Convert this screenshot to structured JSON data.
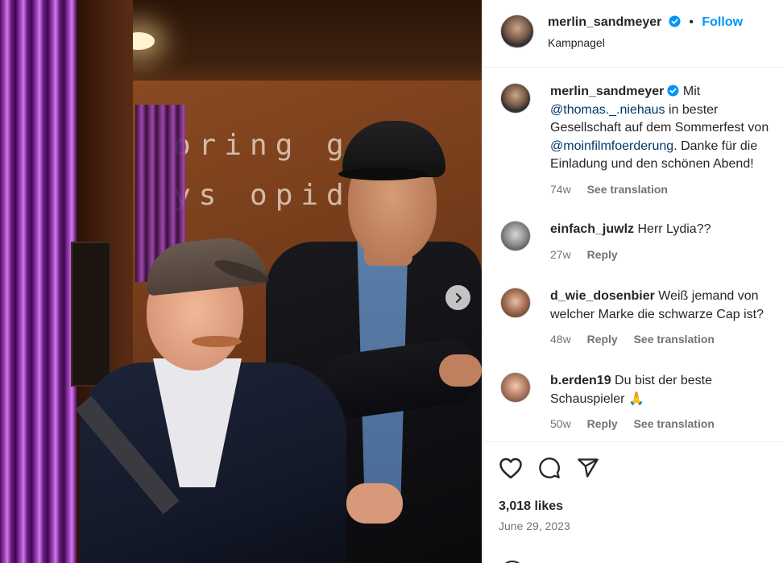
{
  "post": {
    "image_alt": "",
    "next_icon": "chevron-right-icon"
  },
  "header": {
    "username": "merlin_sandmeyer",
    "separator": "•",
    "follow_label": "Follow",
    "location": "Kampnagel"
  },
  "caption": {
    "username": "merlin_sandmeyer",
    "text_parts": [
      "Mit ",
      "@thomas._.niehaus",
      " in bester Gesellschaft auf dem Sommerfest von ",
      "@moinfilmfoerderung",
      ". Danke für die Einladung und den schönen Abend!"
    ],
    "time": "74w",
    "translate": "See translation"
  },
  "comments": [
    {
      "username": "einfach_juwlz",
      "text": "Herr Lydia??",
      "time": "27w",
      "reply": "Reply",
      "translate": ""
    },
    {
      "username": "d_wie_dosenbier",
      "text": "Weiß jemand von welcher Marke die schwarze Cap ist?",
      "time": "48w",
      "reply": "Reply",
      "translate": "See translation"
    },
    {
      "username": "b.erden19",
      "text": "Du bist der beste Schauspieler 🙏",
      "time": "50w",
      "reply": "Reply",
      "translate": "See translation"
    }
  ],
  "actions": {
    "likes": "3,018 likes",
    "date": "June 29, 2023"
  },
  "colors": {
    "accent": "#0095f6",
    "mention": "#00376b",
    "secondary_text": "#737373",
    "verified": "#0095f6"
  }
}
